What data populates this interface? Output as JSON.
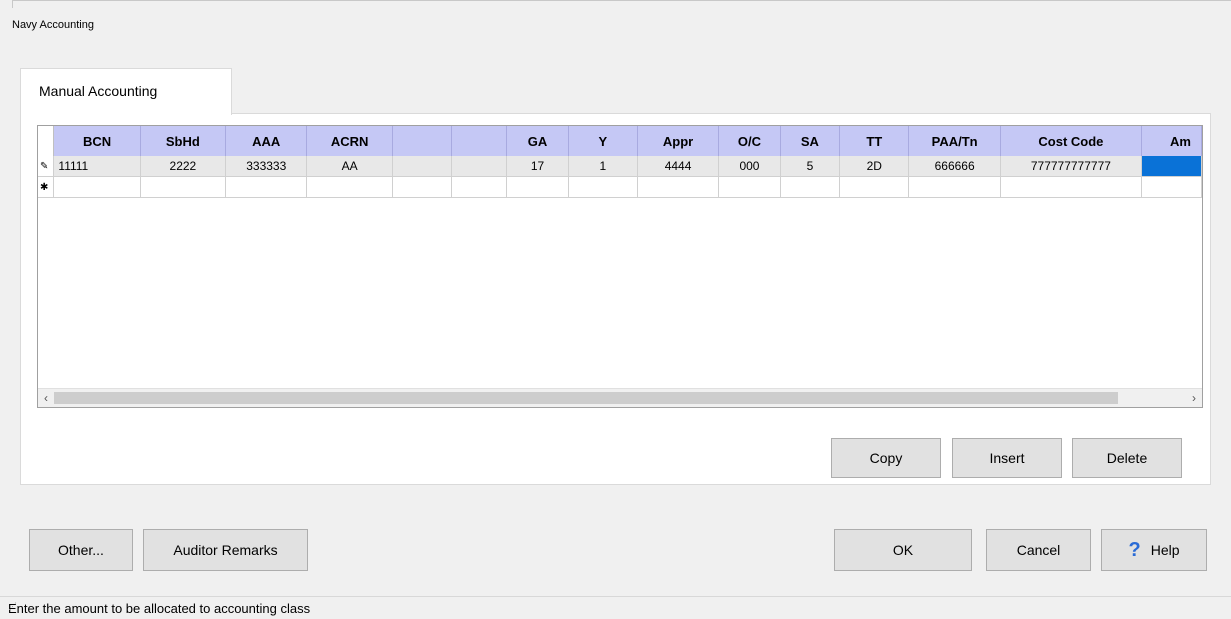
{
  "window": {
    "title": "Navy Accounting"
  },
  "tab": {
    "label": "Manual Accounting"
  },
  "grid": {
    "columns": [
      "BCN",
      "SbHd",
      "AAA",
      "ACRN",
      "",
      "",
      "GA",
      "Y",
      "Appr",
      "O/C",
      "SA",
      "TT",
      "PAA/Tn",
      "Cost Code",
      "Am"
    ],
    "rows": [
      {
        "marker": "✎",
        "cells": [
          "11111",
          "2222",
          "333333",
          "AA",
          "",
          "",
          "17",
          "1",
          "4444",
          "000",
          "5",
          "2D",
          "666666",
          "777777777777",
          ""
        ]
      },
      {
        "marker": "✱",
        "cells": [
          "",
          "",
          "",
          "",
          "",
          "",
          "",
          "",
          "",
          "",
          "",
          "",
          "",
          "",
          ""
        ]
      }
    ],
    "scroll_left": "‹",
    "scroll_right": "›"
  },
  "grid_buttons": {
    "copy": "Copy",
    "insert": "Insert",
    "delete": "Delete"
  },
  "footer_buttons": {
    "other": "Other...",
    "auditor": "Auditor Remarks",
    "ok": "OK",
    "cancel": "Cancel",
    "help": "Help",
    "help_icon": "?"
  },
  "status": {
    "text": "Enter the amount to be allocated to accounting class"
  },
  "colors": {
    "header_bg": "#c5c8f5",
    "active_cell": "#0a72d7"
  }
}
